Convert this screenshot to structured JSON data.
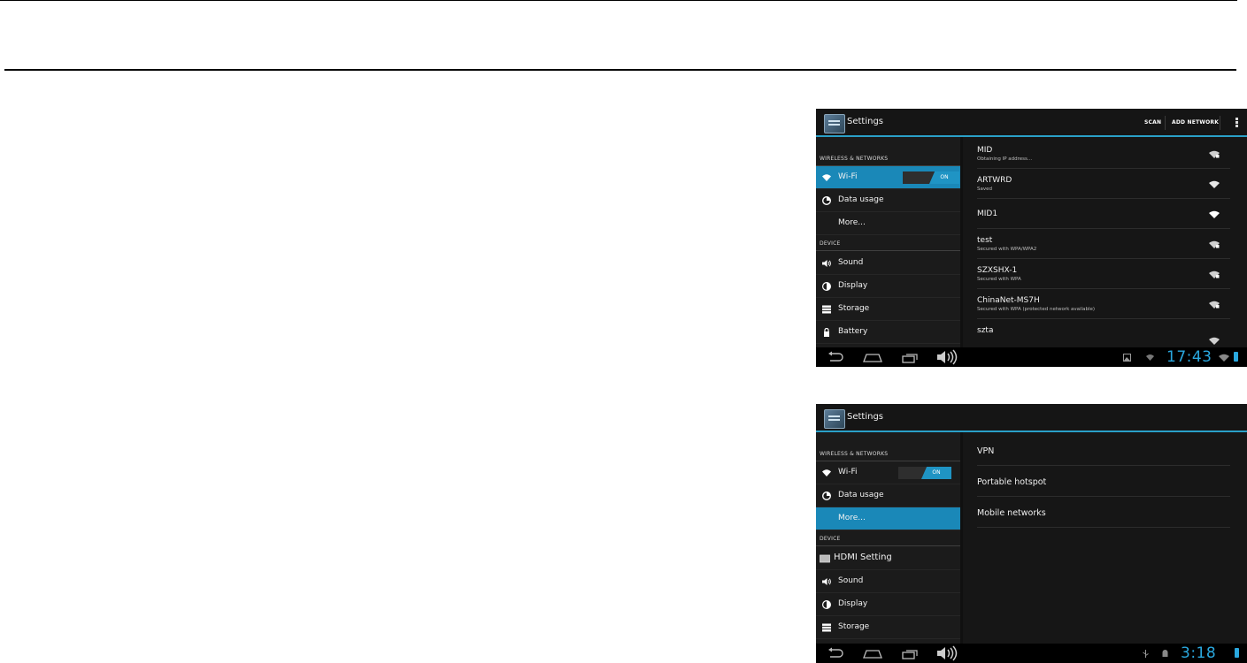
{
  "shot1": {
    "app_title": "Settings",
    "actions": {
      "scan": "SCAN",
      "add_network": "ADD NETWORK"
    },
    "sections": {
      "wireless": "WIRELESS & NETWORKS",
      "device": "DEVICE"
    },
    "menu": {
      "wifi": "Wi-Fi",
      "wifi_toggle": "ON",
      "data_usage": "Data usage",
      "more": "More...",
      "sound": "Sound",
      "display": "Display",
      "storage": "Storage",
      "battery": "Battery"
    },
    "networks": [
      {
        "name": "MID",
        "status": "Obtaining IP address..."
      },
      {
        "name": "ARTWRD",
        "status": "Saved"
      },
      {
        "name": "MID1",
        "status": ""
      },
      {
        "name": "test",
        "status": "Secured with WPA/WPA2"
      },
      {
        "name": "SZXSHX-1",
        "status": "Secured with WPA"
      },
      {
        "name": "ChinaNet-MS7H",
        "status": "Secured with WPA (protected network available)"
      },
      {
        "name": "szta",
        "status": ""
      }
    ],
    "clock": "17:43"
  },
  "shot2": {
    "app_title": "Settings",
    "sections": {
      "wireless": "WIRELESS & NETWORKS",
      "device": "DEVICE"
    },
    "menu": {
      "wifi": "Wi-Fi",
      "wifi_toggle": "ON",
      "data_usage": "Data usage",
      "more": "More...",
      "hdmi": "HDMI Setting",
      "sound": "Sound",
      "display": "Display",
      "storage": "Storage"
    },
    "options": [
      "VPN",
      "Portable hotspot",
      "Mobile networks"
    ],
    "clock": "3:18"
  },
  "colors": {
    "accent": "#2aa8df",
    "selected": "#1a88b8",
    "background": "#101010"
  },
  "icons": [
    "wifi-icon",
    "data-usage-icon",
    "sound-icon",
    "display-icon",
    "storage-icon",
    "battery-icon",
    "hdmi-icon",
    "back-icon",
    "home-icon",
    "recent-apps-icon",
    "volume-icon",
    "overflow-menu-icon"
  ]
}
